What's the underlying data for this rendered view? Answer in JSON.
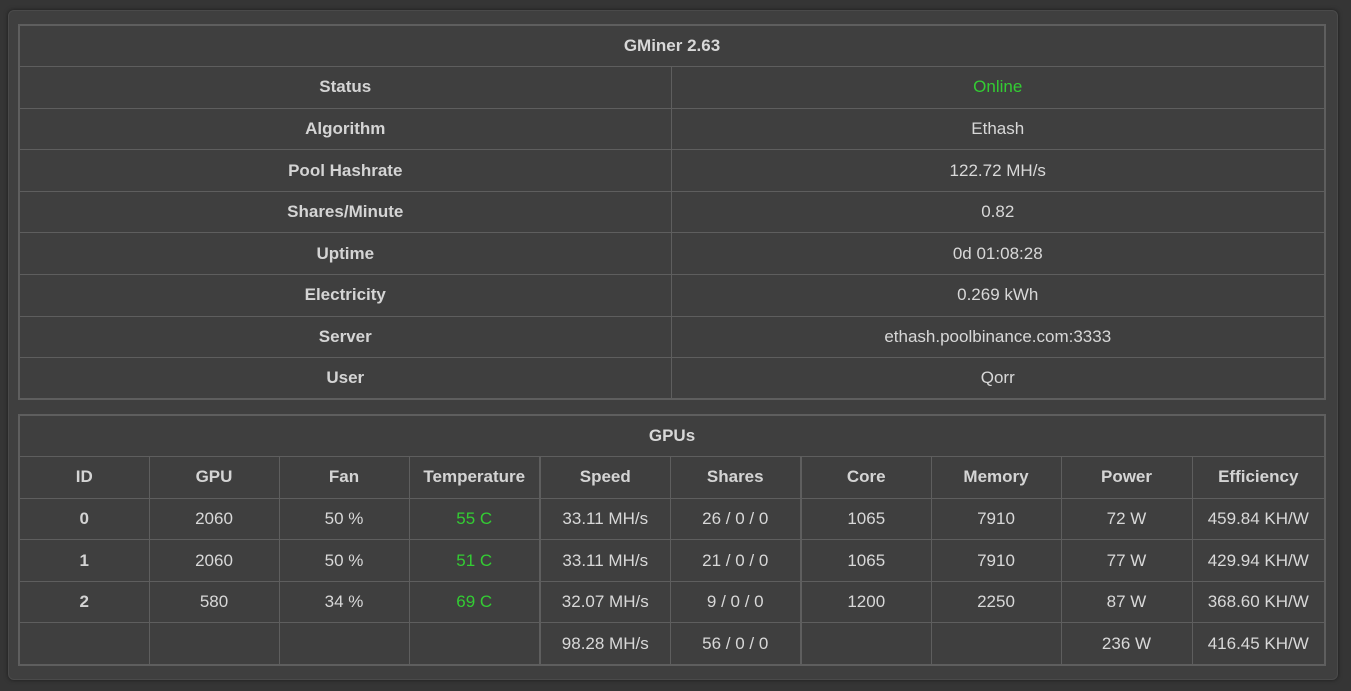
{
  "summary": {
    "title": "GMiner 2.63",
    "rows": [
      {
        "label": "Status",
        "value": "Online"
      },
      {
        "label": "Algorithm",
        "value": "Ethash"
      },
      {
        "label": "Pool Hashrate",
        "value": "122.72 MH/s"
      },
      {
        "label": "Shares/Minute",
        "value": "0.82"
      },
      {
        "label": "Uptime",
        "value": "0d 01:08:28"
      },
      {
        "label": "Electricity",
        "value": "0.269 kWh"
      },
      {
        "label": "Server",
        "value": "ethash.poolbinance.com:3333"
      },
      {
        "label": "User",
        "value": "Qorr"
      }
    ],
    "status_color": "#33cc33"
  },
  "gpus": {
    "title": "GPUs",
    "headers": [
      "ID",
      "GPU",
      "Fan",
      "Temperature",
      "Speed",
      "Shares",
      "Core",
      "Memory",
      "Power",
      "Efficiency"
    ],
    "rows": [
      {
        "id": "0",
        "gpu": "2060",
        "fan": "50 %",
        "temp": "55 C",
        "speed": "33.11 MH/s",
        "shares": "26 / 0 / 0",
        "core": "1065",
        "memory": "7910",
        "power": "72 W",
        "efficiency": "459.84 KH/W"
      },
      {
        "id": "1",
        "gpu": "2060",
        "fan": "50 %",
        "temp": "51 C",
        "speed": "33.11 MH/s",
        "shares": "21 / 0 / 0",
        "core": "1065",
        "memory": "7910",
        "power": "77 W",
        "efficiency": "429.94 KH/W"
      },
      {
        "id": "2",
        "gpu": "580",
        "fan": "34 %",
        "temp": "69 C",
        "speed": "32.07 MH/s",
        "shares": "9 / 0 / 0",
        "core": "1200",
        "memory": "2250",
        "power": "87 W",
        "efficiency": "368.60 KH/W"
      }
    ],
    "totals": {
      "speed": "98.28 MH/s",
      "shares": "56 / 0 / 0",
      "power": "236 W",
      "efficiency": "416.45 KH/W"
    },
    "temp_color": "#33cc33"
  }
}
